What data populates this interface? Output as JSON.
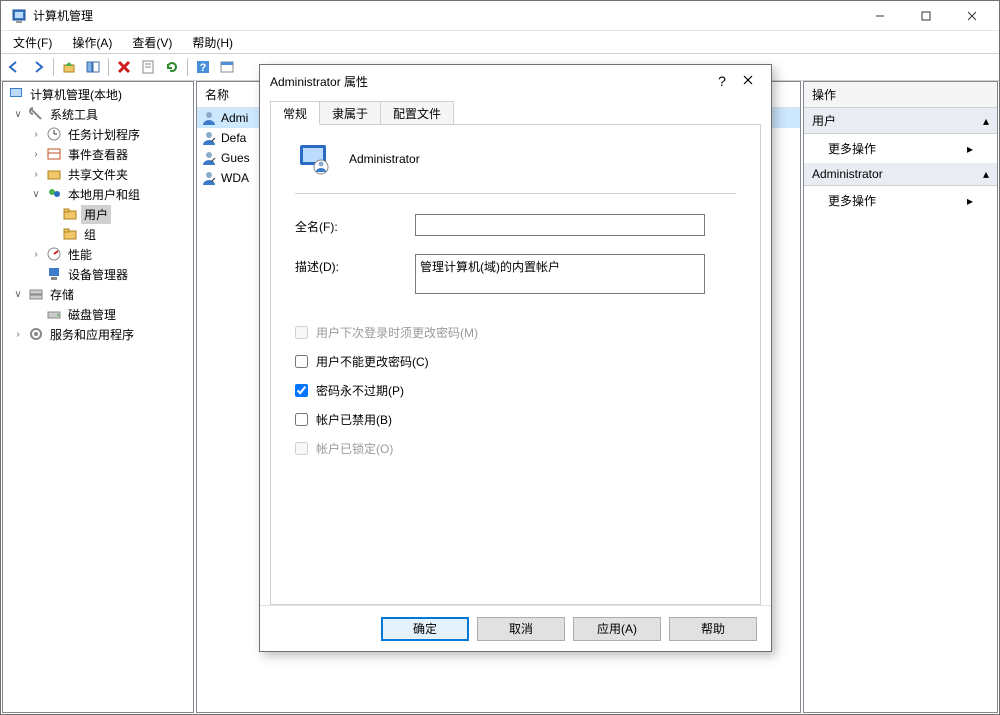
{
  "window": {
    "title": "计算机管理"
  },
  "menu": {
    "file": "文件(F)",
    "action": "操作(A)",
    "view": "查看(V)",
    "help": "帮助(H)"
  },
  "tree": {
    "root": "计算机管理(本地)",
    "system_tools": "系统工具",
    "task_scheduler": "任务计划程序",
    "event_viewer": "事件查看器",
    "shared_folders": "共享文件夹",
    "local_users_groups": "本地用户和组",
    "users": "用户",
    "groups": "组",
    "performance": "性能",
    "device_manager": "设备管理器",
    "storage": "存储",
    "disk_management": "磁盘管理",
    "services_apps": "服务和应用程序"
  },
  "list": {
    "header_name": "名称",
    "items": [
      {
        "name": "Admi"
      },
      {
        "name": "Defa"
      },
      {
        "name": "Gues"
      },
      {
        "name": "WDA"
      }
    ]
  },
  "actions": {
    "header": "操作",
    "group1": "用户",
    "more1": "更多操作",
    "group2": "Administrator",
    "more2": "更多操作"
  },
  "dialog": {
    "title": "Administrator 属性",
    "tabs": {
      "general": "常规",
      "memberof": "隶属于",
      "profile": "配置文件"
    },
    "username": "Administrator",
    "fullname_label": "全名(F):",
    "fullname_value": "",
    "description_label": "描述(D):",
    "description_value": "管理计算机(域)的内置帐户",
    "cb_must_change": "用户下次登录时须更改密码(M)",
    "cb_cannot_change": "用户不能更改密码(C)",
    "cb_never_expire": "密码永不过期(P)",
    "cb_disabled": "帐户已禁用(B)",
    "cb_locked": "帐户已锁定(O)",
    "btn_ok": "确定",
    "btn_cancel": "取消",
    "btn_apply": "应用(A)",
    "btn_help": "帮助"
  }
}
